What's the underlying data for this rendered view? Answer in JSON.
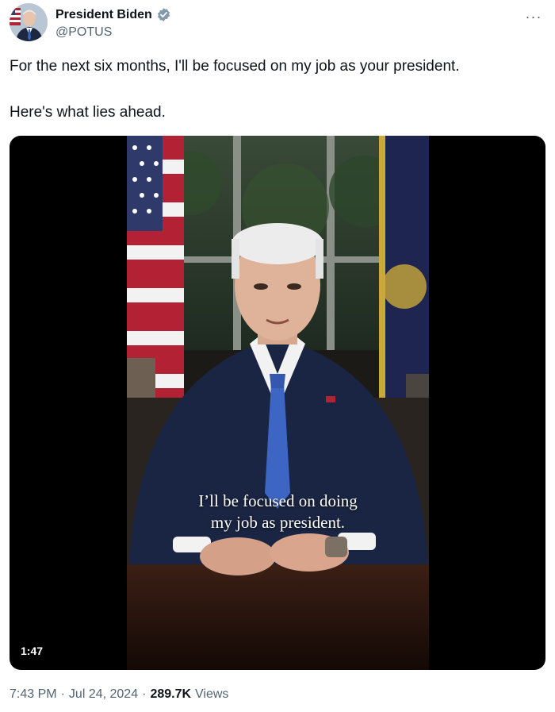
{
  "tweet": {
    "author": {
      "display_name": "President Biden",
      "handle": "@POTUS",
      "verified_icon": "verified-badge-icon"
    },
    "more_icon": "more-options-icon",
    "more_label": "···",
    "text_lines": [
      "For the next six months, I'll be focused on my job as your president.",
      "Here's what lies ahead."
    ],
    "media": {
      "type": "video",
      "caption_line1": "I’ll be focused on doing",
      "caption_line2": "my job as president.",
      "duration": "1:47"
    },
    "meta": {
      "time": "7:43 PM",
      "sep1": "·",
      "date": "Jul 24, 2024",
      "sep2": "·",
      "views_count": "289.7K",
      "views_label": "Views"
    }
  },
  "colors": {
    "text_primary": "#0f1419",
    "text_secondary": "#536471",
    "verified_blue": "#829aab",
    "media_background": "#000000"
  }
}
